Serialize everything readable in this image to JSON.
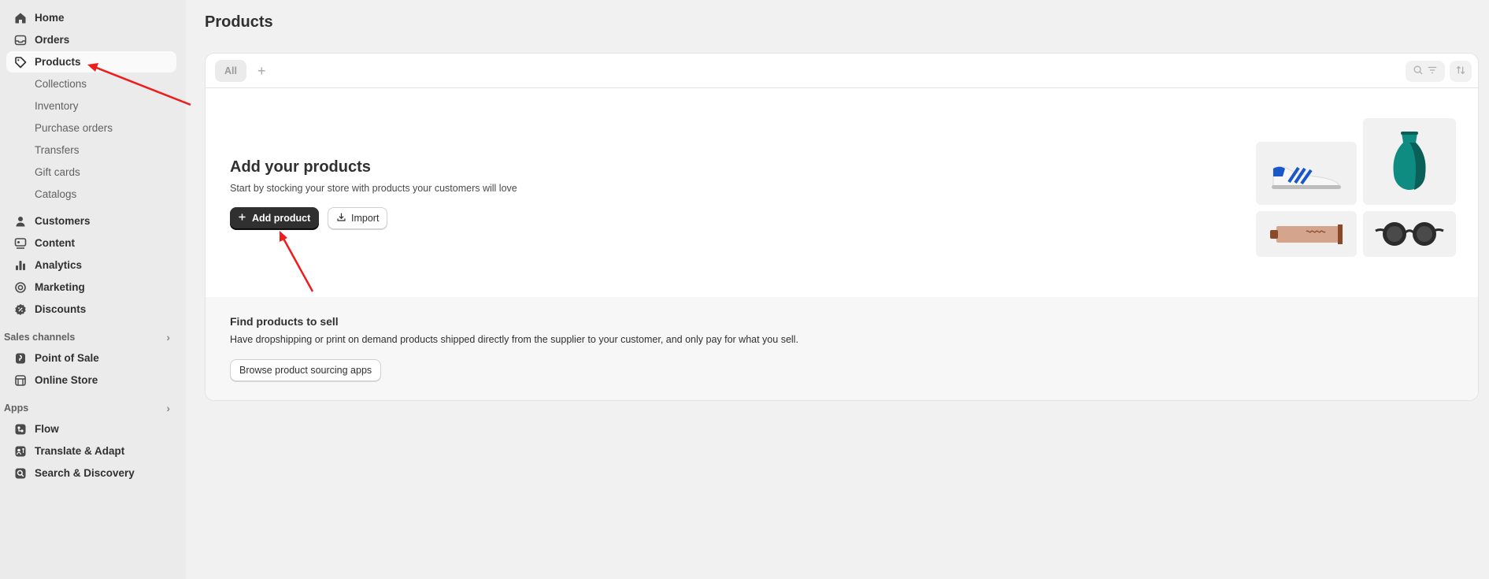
{
  "sidebar": {
    "main_items": [
      {
        "label": "Home",
        "icon": "home-icon"
      },
      {
        "label": "Orders",
        "icon": "inbox-icon"
      },
      {
        "label": "Products",
        "icon": "tag-icon",
        "active": true
      }
    ],
    "product_subitems": [
      "Collections",
      "Inventory",
      "Purchase orders",
      "Transfers",
      "Gift cards",
      "Catalogs"
    ],
    "more_items": [
      {
        "label": "Customers",
        "icon": "person-icon"
      },
      {
        "label": "Content",
        "icon": "content-icon"
      },
      {
        "label": "Analytics",
        "icon": "bar-chart-icon"
      },
      {
        "label": "Marketing",
        "icon": "target-icon"
      },
      {
        "label": "Discounts",
        "icon": "discount-icon"
      }
    ],
    "sales_channels": {
      "heading": "Sales channels",
      "items": [
        {
          "label": "Point of Sale",
          "icon": "pos-icon"
        },
        {
          "label": "Online Store",
          "icon": "store-icon"
        }
      ]
    },
    "apps": {
      "heading": "Apps",
      "items": [
        {
          "label": "Flow",
          "icon": "flow-icon"
        },
        {
          "label": "Translate & Adapt",
          "icon": "translate-icon"
        },
        {
          "label": "Search & Discovery",
          "icon": "search-app-icon"
        }
      ]
    }
  },
  "page": {
    "title": "Products",
    "tabs": {
      "all": "All",
      "add": "+"
    },
    "empty_state": {
      "heading": "Add your products",
      "description": "Start by stocking your store with products your customers will love",
      "primary_button": "Add product",
      "secondary_button": "Import"
    },
    "find": {
      "heading": "Find products to sell",
      "description": "Have dropshipping or print on demand products shipped directly from the supplier to your customer, and only pay for what you sell.",
      "button": "Browse product sourcing apps"
    }
  },
  "colors": {
    "annotation_arrow": "#ee1c1c",
    "primary_button": "#303030",
    "sidebar_bg": "#ebebeb",
    "page_bg": "#f1f1f1"
  }
}
